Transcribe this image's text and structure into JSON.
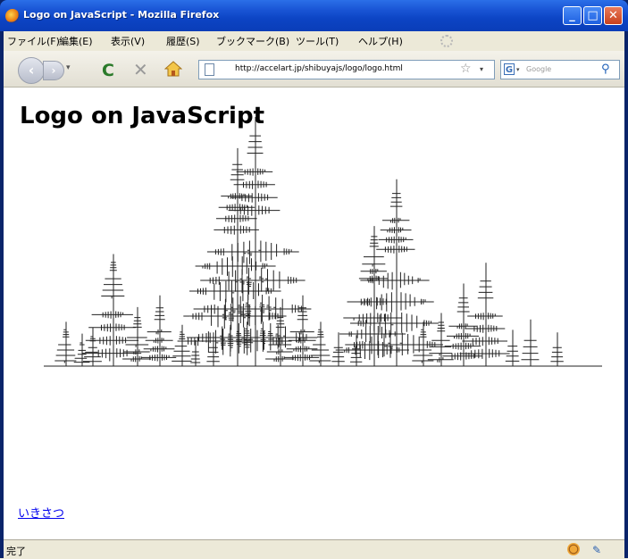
{
  "window": {
    "title": "Logo on JavaScript - Mozilla Firefox"
  },
  "window_controls": {
    "minimize": "_",
    "maximize": "□",
    "close": "✕"
  },
  "menu": [
    "ファイル(F)",
    "編集(E)",
    "表示(V)",
    "履歴(S)",
    "ブックマーク(B)",
    "ツール(T)",
    "ヘルプ(H)"
  ],
  "nav": {
    "back": "‹",
    "forward": "›",
    "history_dropdown": "▾",
    "reload": "C",
    "stop": "✕",
    "url": "http://accelart.jp/shibuyajs/logo/logo.html",
    "bookmark_star": "☆",
    "url_dropdown": "▾",
    "search_engine": "G",
    "search_engine_dropdown": "▾",
    "search_placeholder": "Google",
    "search_button": "⚲"
  },
  "page": {
    "title": "Logo on JavaScript",
    "link": "いきさつ"
  },
  "status": {
    "text": "完了"
  },
  "colors": {
    "titlebar": "#0c44c4",
    "link": "#0000ee",
    "drawing": "#222222"
  }
}
